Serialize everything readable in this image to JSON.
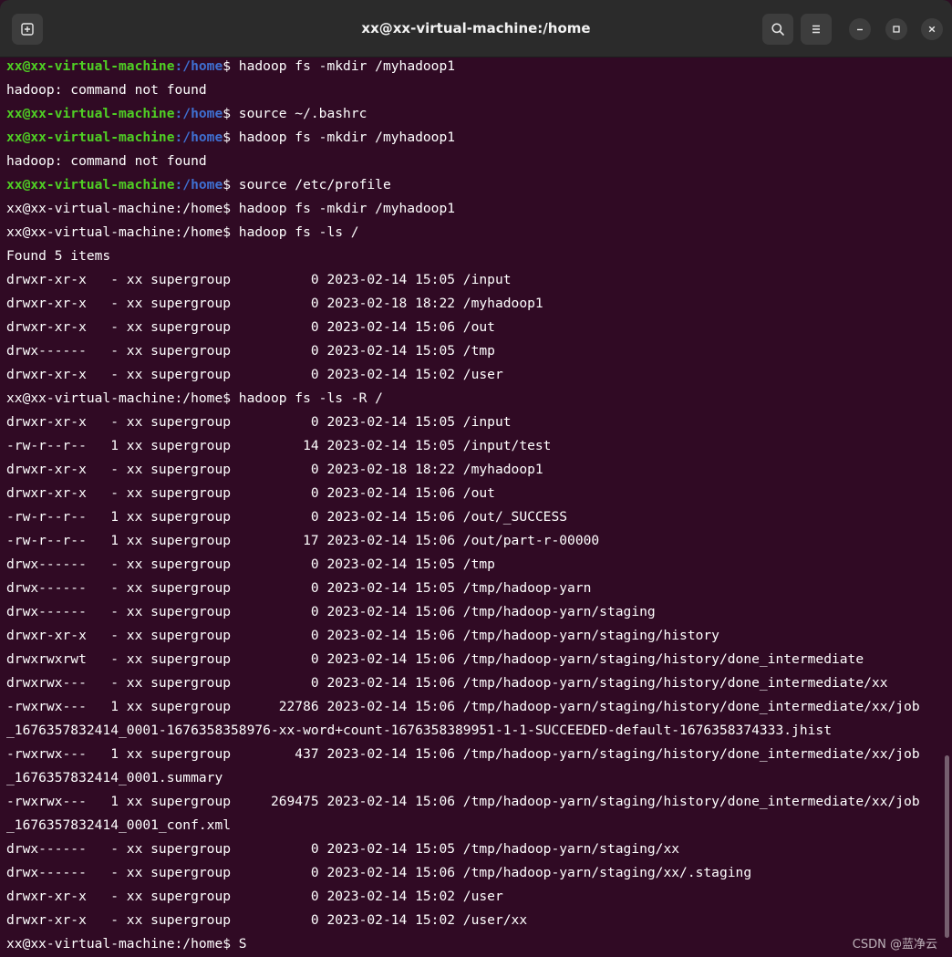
{
  "window": {
    "title": "xx@xx-virtual-machine:/home",
    "icons": {
      "new_tab": "new-tab-icon",
      "search": "search-icon",
      "menu": "hamburger-menu-icon",
      "minimize": "minimize-icon",
      "maximize": "maximize-icon",
      "close": "close-icon"
    }
  },
  "terminal": {
    "colors": {
      "background": "#300a24",
      "text": "#ffffff",
      "prompt_user": "#4fcf24",
      "prompt_path": "#3f6fd0"
    },
    "lines": [
      {
        "colored": true,
        "user": "xx@xx-virtual-machine",
        "path": ":/home",
        "text": "$ hadoop fs -mkdir /myhadoop1"
      },
      {
        "text": "hadoop: command not found"
      },
      {
        "colored": true,
        "user": "xx@xx-virtual-machine",
        "path": ":/home",
        "text": "$ source ~/.bashrc"
      },
      {
        "colored": true,
        "user": "xx@xx-virtual-machine",
        "path": ":/home",
        "text": "$ hadoop fs -mkdir /myhadoop1"
      },
      {
        "text": "hadoop: command not found"
      },
      {
        "colored": true,
        "user": "xx@xx-virtual-machine",
        "path": ":/home",
        "text": "$ source /etc/profile"
      },
      {
        "text": "xx@xx-virtual-machine:/home$ hadoop fs -mkdir /myhadoop1"
      },
      {
        "text": "xx@xx-virtual-machine:/home$ hadoop fs -ls /"
      },
      {
        "text": "Found 5 items"
      },
      {
        "text": "drwxr-xr-x   - xx supergroup          0 2023-02-14 15:05 /input"
      },
      {
        "text": "drwxr-xr-x   - xx supergroup          0 2023-02-18 18:22 /myhadoop1"
      },
      {
        "text": "drwxr-xr-x   - xx supergroup          0 2023-02-14 15:06 /out"
      },
      {
        "text": "drwx------   - xx supergroup          0 2023-02-14 15:05 /tmp"
      },
      {
        "text": "drwxr-xr-x   - xx supergroup          0 2023-02-14 15:02 /user"
      },
      {
        "text": "xx@xx-virtual-machine:/home$ hadoop fs -ls -R /"
      },
      {
        "text": "drwxr-xr-x   - xx supergroup          0 2023-02-14 15:05 /input"
      },
      {
        "text": "-rw-r--r--   1 xx supergroup         14 2023-02-14 15:05 /input/test"
      },
      {
        "text": "drwxr-xr-x   - xx supergroup          0 2023-02-18 18:22 /myhadoop1"
      },
      {
        "text": "drwxr-xr-x   - xx supergroup          0 2023-02-14 15:06 /out"
      },
      {
        "text": "-rw-r--r--   1 xx supergroup          0 2023-02-14 15:06 /out/_SUCCESS"
      },
      {
        "text": "-rw-r--r--   1 xx supergroup         17 2023-02-14 15:06 /out/part-r-00000"
      },
      {
        "text": "drwx------   - xx supergroup          0 2023-02-14 15:05 /tmp"
      },
      {
        "text": "drwx------   - xx supergroup          0 2023-02-14 15:05 /tmp/hadoop-yarn"
      },
      {
        "text": "drwx------   - xx supergroup          0 2023-02-14 15:06 /tmp/hadoop-yarn/staging"
      },
      {
        "text": "drwxr-xr-x   - xx supergroup          0 2023-02-14 15:06 /tmp/hadoop-yarn/staging/history"
      },
      {
        "text": "drwxrwxrwt   - xx supergroup          0 2023-02-14 15:06 /tmp/hadoop-yarn/staging/history/done_intermediate"
      },
      {
        "text": "drwxrwx---   - xx supergroup          0 2023-02-14 15:06 /tmp/hadoop-yarn/staging/history/done_intermediate/xx"
      },
      {
        "text": "-rwxrwx---   1 xx supergroup      22786 2023-02-14 15:06 /tmp/hadoop-yarn/staging/history/done_intermediate/xx/job"
      },
      {
        "text": "_1676357832414_0001-1676358358976-xx-word+count-1676358389951-1-1-SUCCEEDED-default-1676358374333.jhist"
      },
      {
        "text": "-rwxrwx---   1 xx supergroup        437 2023-02-14 15:06 /tmp/hadoop-yarn/staging/history/done_intermediate/xx/job"
      },
      {
        "text": "_1676357832414_0001.summary"
      },
      {
        "text": "-rwxrwx---   1 xx supergroup     269475 2023-02-14 15:06 /tmp/hadoop-yarn/staging/history/done_intermediate/xx/job"
      },
      {
        "text": "_1676357832414_0001_conf.xml"
      },
      {
        "text": "drwx------   - xx supergroup          0 2023-02-14 15:05 /tmp/hadoop-yarn/staging/xx"
      },
      {
        "text": "drwx------   - xx supergroup          0 2023-02-14 15:06 /tmp/hadoop-yarn/staging/xx/.staging"
      },
      {
        "text": "drwxr-xr-x   - xx supergroup          0 2023-02-14 15:02 /user"
      },
      {
        "text": "drwxr-xr-x   - xx supergroup          0 2023-02-14 15:02 /user/xx"
      },
      {
        "text": "xx@xx-virtual-machine:/home$ S"
      }
    ]
  },
  "watermark": "CSDN @蓝净云"
}
